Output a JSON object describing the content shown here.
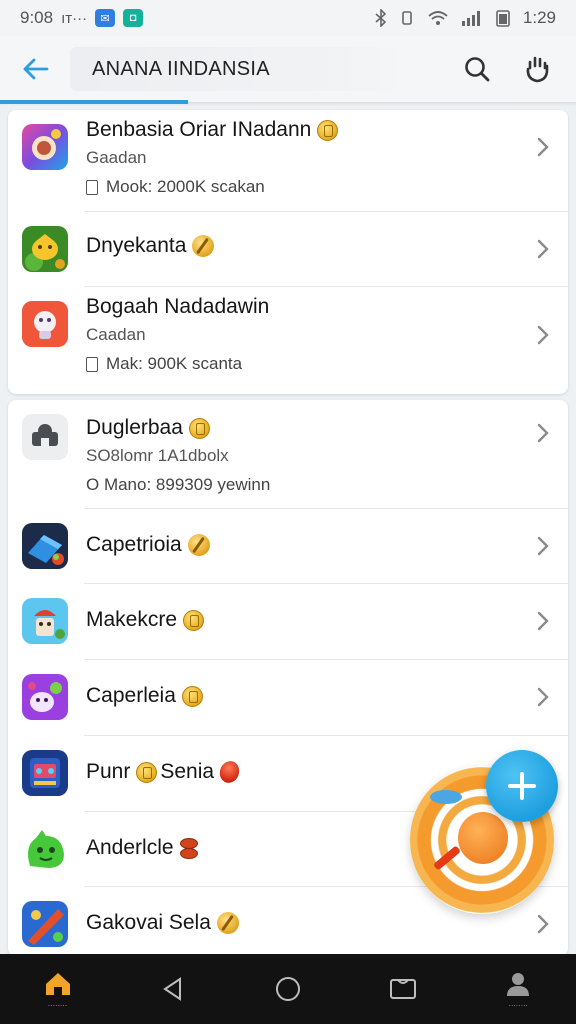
{
  "status_bar": {
    "time_left": "9:08",
    "carrier": "ıт···",
    "time_right": "1:29"
  },
  "app_bar": {
    "search_value": "ANANA IINDANSIA",
    "icons": [
      "back-arrow-icon",
      "search-icon",
      "hand-icon"
    ]
  },
  "colors": {
    "accent": "#2d9de0",
    "fab": "#1e9fe0",
    "orange": "#f59a2c",
    "nav_bg": "#121212"
  },
  "list_groups": [
    {
      "items": [
        {
          "title": "Benbasia Oriar INadann",
          "subtitle": "Gaadan",
          "meta": "Mook:  2000K  scakan",
          "badge": "coin"
        },
        {
          "title": "Dnyekanta",
          "badge": "coin-leaf"
        },
        {
          "title": "Bogaah Nadadawin",
          "subtitle": "Caadan",
          "meta": "Mak:  900K  scanta",
          "badge": "none"
        }
      ]
    },
    {
      "items": [
        {
          "title": "Duglerbaa",
          "subtitle": "SO8lomr 1A1dbolx",
          "meta": "O Mano:  899309 yewinn",
          "badge": "coin"
        },
        {
          "title": "Capetrioia",
          "badge": "coin-leaf"
        },
        {
          "title": "Makekcre",
          "badge": "coin"
        },
        {
          "title": "Caperleia",
          "badge": "coin"
        },
        {
          "title": "Punr",
          "title_suffix": "Senia",
          "badge": "coin-red"
        },
        {
          "title": "Anderlcle",
          "badge": "coin-stack"
        },
        {
          "title": "Gakovai Sela",
          "badge": "coin-leaf"
        }
      ]
    }
  ],
  "bottom_nav": {
    "home_label": "........",
    "profile_label": "........",
    "icons": [
      "home-icon",
      "back-triangle-icon",
      "home-circle-icon",
      "recents-icon",
      "profile-icon"
    ]
  }
}
